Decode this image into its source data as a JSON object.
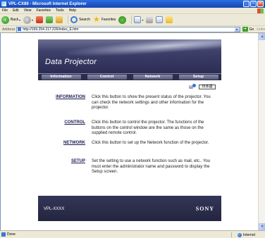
{
  "window": {
    "title": "VPL-CX86 - Microsoft Internet Explorer"
  },
  "menubar": {
    "items": [
      "File",
      "Edit",
      "View",
      "Favorites",
      "Tools",
      "Help"
    ]
  },
  "toolbar": {
    "back_label": "Back",
    "search_label": "Search",
    "favorites_label": "Favorites"
  },
  "addressbar": {
    "label": "Address",
    "url": "http://169.254.217.226/index_E.htm",
    "go_label": "Go",
    "links_label": "Links"
  },
  "page": {
    "banner_title": "Data Projector",
    "nav": [
      "Information",
      "Control",
      "Network",
      "Setup"
    ],
    "language_button": "日本語",
    "sections": [
      {
        "link": "INFORMATION",
        "description": "Click this button to show the present status of the projector. You can check the network settings and other information for the projector."
      },
      {
        "link": "CONTROL",
        "description": "Click this button to control the projector. The functions of the buttons on the control window are the same as those on the supplied remote control."
      },
      {
        "link": "NETWORK",
        "description": "Click this button to set up the Network function of the projector."
      },
      {
        "link": "SETUP",
        "description": "Set the setting to use a network function such as mail, etc.. You must enter the administrator name and password to display the Setup screen."
      }
    ],
    "footer_model": "VPL-XXXX",
    "footer_brand": "SONY"
  },
  "statusbar": {
    "status": "Done",
    "zone": "Internet"
  },
  "icons": {
    "back": "back-arrow-icon",
    "forward": "forward-arrow-icon",
    "stop": "stop-icon",
    "refresh": "refresh-icon",
    "home": "home-icon",
    "search": "search-icon",
    "favorites": "favorites-star-icon",
    "history": "history-icon",
    "mail": "mail-icon",
    "print": "print-icon",
    "folder": "folder-icon",
    "language": "language-icon",
    "internet_zone": "internet-globe-icon"
  },
  "colors": {
    "titlebar": "#1f55c8",
    "chrome": "#ece9d8",
    "banner": "#2b2d55",
    "nav_button": "#545676",
    "footer": "#23253f",
    "link_text": "#1a1a55"
  }
}
